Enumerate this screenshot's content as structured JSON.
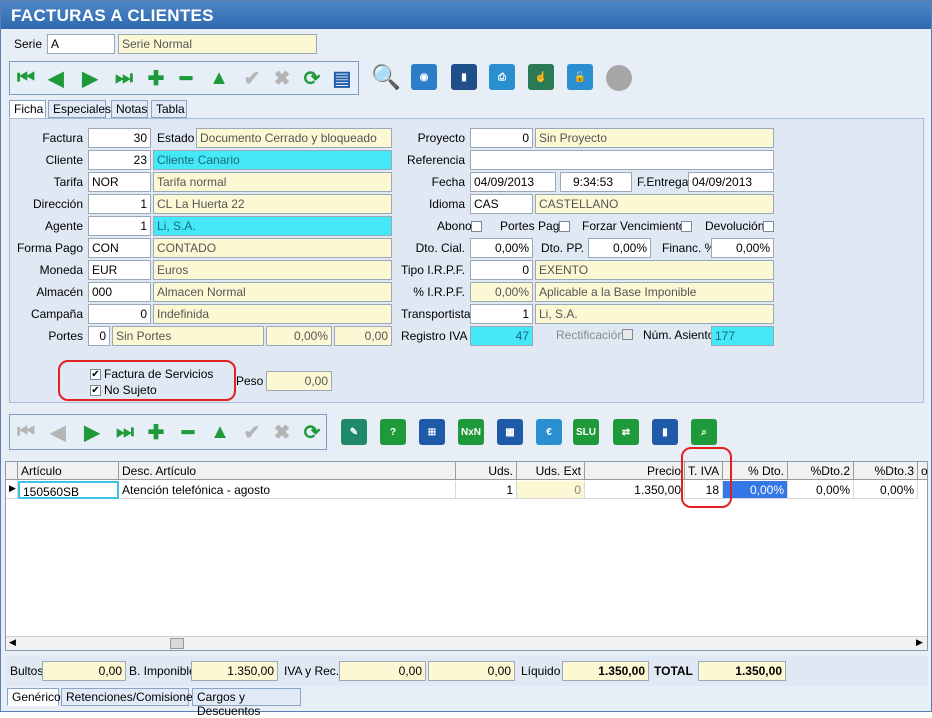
{
  "window": {
    "title": "FACTURAS A CLIENTES"
  },
  "serie": {
    "label": "Serie",
    "code": "A",
    "name": "Serie Normal"
  },
  "tabs": [
    {
      "label": "Ficha"
    },
    {
      "label": "Especiales"
    },
    {
      "label": "Notas"
    },
    {
      "label": "Tabla"
    }
  ],
  "form": {
    "factura": {
      "label": "Factura",
      "value": "30"
    },
    "estado": {
      "label": "Estado",
      "value": "Documento Cerrado y bloqueado"
    },
    "cliente": {
      "label": "Cliente",
      "code": "23",
      "name": "Cliente Canario"
    },
    "tarifa": {
      "label": "Tarifa",
      "code": "NOR",
      "name": "Tarifa normal"
    },
    "direccion": {
      "label": "Dirección",
      "code": "1",
      "name": "CL  La Huerta 22"
    },
    "agente": {
      "label": "Agente",
      "code": "1",
      "name": "Li, S.A."
    },
    "forma_pago": {
      "label": "Forma Pago",
      "code": "CON",
      "name": "CONTADO"
    },
    "moneda": {
      "label": "Moneda",
      "code": "EUR",
      "name": "Euros"
    },
    "almacen": {
      "label": "Almacén",
      "code": "000",
      "name": "Almacen Normal"
    },
    "campana": {
      "label": "Campaña",
      "code": "0",
      "name": "Indefinida"
    },
    "portes": {
      "label": "Portes",
      "code": "0",
      "name": "Sin Portes",
      "pct": "0,00%",
      "amount": "0,00"
    },
    "proyecto": {
      "label": "Proyecto",
      "code": "0",
      "name": "Sin Proyecto"
    },
    "referencia": {
      "label": "Referencia",
      "value": ""
    },
    "fecha": {
      "label": "Fecha",
      "date": "04/09/2013",
      "time": "9:34:53"
    },
    "f_entrega": {
      "label": "F.Entrega",
      "date": "04/09/2013"
    },
    "idioma": {
      "label": "Idioma",
      "code": "CAS",
      "name": "CASTELLANO"
    },
    "abono": {
      "label": "Abono",
      "checked": false
    },
    "portes_pag": {
      "label": "Portes Pag.",
      "checked": false
    },
    "forzar_venc": {
      "label": "Forzar Vencimientos",
      "checked": false
    },
    "devolucion": {
      "label": "Devolución",
      "checked": false
    },
    "dto_cial": {
      "label": "Dto. Cial.",
      "value": "0,00%"
    },
    "dto_pp": {
      "label": "Dto. PP.",
      "value": "0,00%"
    },
    "financ": {
      "label": "Financ. %",
      "value": "0,00%"
    },
    "tipo_irpf": {
      "label": "Tipo I.R.P.F.",
      "code": "0",
      "name": "EXENTO"
    },
    "pct_irpf": {
      "label": "% I.R.P.F.",
      "value": "0,00%",
      "name": "Aplicable a la Base Imponible"
    },
    "transportista": {
      "label": "Transportista",
      "code": "1",
      "name": "Li, S.A."
    },
    "registro_iva": {
      "label": "Registro IVA",
      "value": "47"
    },
    "rectificacion": {
      "label": "Rectificación",
      "checked": false
    },
    "num_asiento": {
      "label": "Núm. Asiento",
      "value": "177"
    },
    "factura_servicios": {
      "label": "Factura de Servicios",
      "checked": true
    },
    "no_sujeto": {
      "label": "No Sujeto",
      "checked": true
    },
    "peso": {
      "label": "Peso",
      "value": "0,00"
    }
  },
  "grid": {
    "columns": [
      "Artículo",
      "Desc. Artículo",
      "Uds.",
      "Uds. Ext",
      "Precio",
      "T. IVA",
      "% Dto.",
      "%Dto.2",
      "%Dto.3",
      "o"
    ],
    "rows": [
      {
        "articulo": "150560SB",
        "desc": "Atención telefónica - agosto",
        "uds": "1",
        "uds_ext": "0",
        "precio": "1.350,00",
        "t_iva": "18",
        "dto": "0,00%",
        "dto2": "0,00%",
        "dto3": "0,00%"
      }
    ]
  },
  "totals": {
    "bultos": {
      "label": "Bultos",
      "value": "0,00"
    },
    "b_imponible": {
      "label": "B. Imponible",
      "value": "1.350,00"
    },
    "iva_rec": {
      "label": "IVA y Rec.",
      "value1": "0,00",
      "value2": "0,00"
    },
    "liquido": {
      "label": "Líquido",
      "value": "1.350,00"
    },
    "total": {
      "label": "TOTAL",
      "value": "1.350,00"
    }
  },
  "bottom_tabs": [
    {
      "label": "Genérico"
    },
    {
      "label": "Retenciones/Comisiones"
    },
    {
      "label": "Cargos y Descuentos"
    }
  ],
  "colors": {
    "accent": "#2d69b0",
    "nav_green": "#1f9a3a",
    "highlight_cyan": "#44e8f6",
    "annotation_red": "#e32020"
  }
}
